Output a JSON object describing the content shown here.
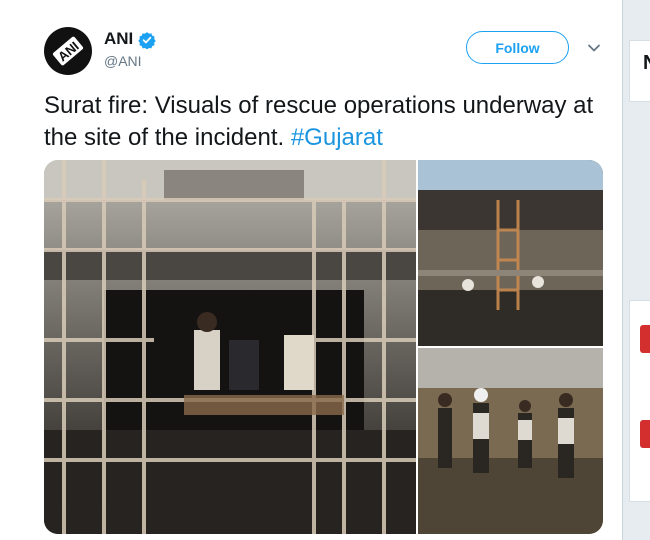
{
  "tweet": {
    "author_name": "ANI",
    "handle": "@ANI",
    "follow_label": "Follow",
    "text": "Surat fire: Visuals of rescue operations underway at the site of the incident.",
    "hashtag": "#Gujarat",
    "avatar_text": "ANI"
  },
  "side": {
    "letter": "N"
  },
  "colors": {
    "accent": "#1da1f2",
    "hashtag": "#1b95e0",
    "text": "#14171a",
    "muted": "#657786"
  },
  "icons": {
    "verified": "verified-badge-icon",
    "more": "chevron-down-icon"
  }
}
